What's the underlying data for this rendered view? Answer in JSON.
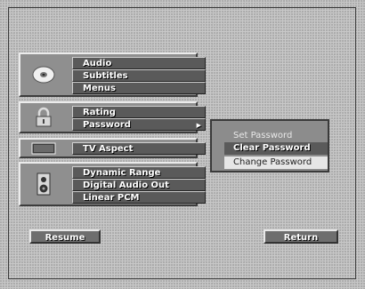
{
  "menu": {
    "disc_group": [
      "Audio",
      "Subtitles",
      "Menus"
    ],
    "rating_group": [
      "Rating",
      "Password"
    ],
    "aspect_group": [
      "TV Aspect"
    ],
    "audio_group": [
      "Dynamic Range",
      "Digital Audio Out",
      "Linear PCM"
    ]
  },
  "password_submenu": {
    "items": [
      "Set Password",
      "Clear Password",
      "Change Password"
    ],
    "highlighted": "Clear Password"
  },
  "buttons": {
    "resume": "Resume",
    "return": "Return"
  },
  "icons": {
    "disc": "disc-icon",
    "rating": "lock-icon",
    "aspect": "tv-icon",
    "audio": "speaker-icon",
    "submenu_arrow": "triangle-right-icon"
  }
}
